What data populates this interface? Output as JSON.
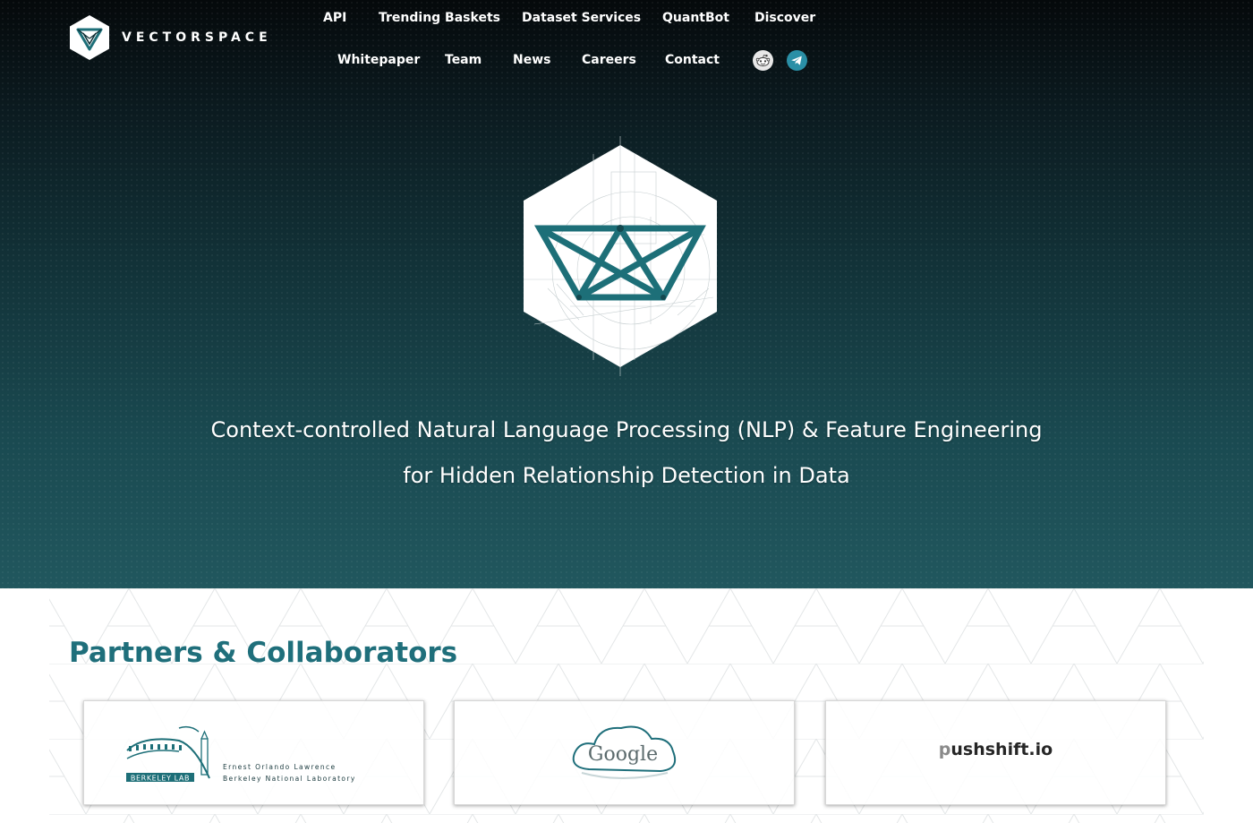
{
  "brand": {
    "name": "VECTORSPACE"
  },
  "nav": {
    "row1": [
      "API",
      "Trending Baskets",
      "Dataset Services",
      "QuantBot",
      "Discover"
    ],
    "row2": [
      "Whitepaper",
      "Team",
      "News",
      "Careers",
      "Contact"
    ]
  },
  "social": [
    {
      "icon": "reddit-icon",
      "color": "#e8e8e8"
    },
    {
      "icon": "telegram-icon",
      "color": "#2a8fa6"
    }
  ],
  "hero": {
    "line1": "Context-controlled Natural Language Processing (NLP) & Feature Engineering",
    "line2": "for Hidden Relationship Detection in Data"
  },
  "partners": {
    "heading": "Partners & Collaborators",
    "cards": [
      {
        "name": "Berkeley Lab",
        "logo_label": "BERKELEY LAB",
        "text_line1": "Ernest Orlando Lawrence",
        "text_line2": "Berkeley National Laboratory"
      },
      {
        "name": "Google",
        "logo_label": "Google"
      },
      {
        "name": "pushshift.io",
        "logo_first": "p",
        "logo_rest": "ushshift.io"
      }
    ]
  },
  "colors": {
    "accent": "#1f6f7b",
    "hero_top": "#05090b",
    "hero_bottom": "#21575e",
    "emblem_basket": "#1d6f78"
  }
}
